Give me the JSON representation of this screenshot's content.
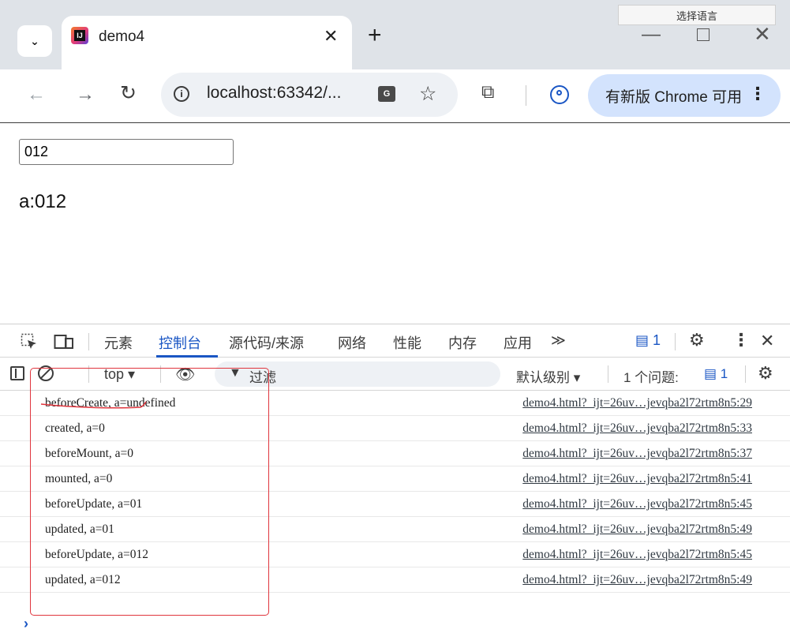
{
  "tooltip": {
    "text": "选择语言"
  },
  "tab": {
    "title": "demo4",
    "favicon_label": "IJ"
  },
  "window_controls": {
    "minimize": "—",
    "close": "✕"
  },
  "toolbar": {
    "url": "localhost:63342/...",
    "update_button_label": "有新版 Chrome 可用",
    "translate_icon_label": "G"
  },
  "page": {
    "input_value": "012",
    "binding_text": "a:012"
  },
  "devtools": {
    "tabs": [
      "元素",
      "控制台",
      "源代码/来源",
      "网络",
      "性能",
      "内存",
      "应用"
    ],
    "more_tabs": "≫",
    "message_count": "1",
    "context": "top ▾",
    "filter_placeholder": "过滤",
    "level": "默认级别 ▾",
    "issues_label": "1 个问题:",
    "issues_count": "1",
    "logs": [
      {
        "message": "beforeCreate, a=undefined",
        "source": "demo4.html?_ijt=26uv…jevqba2l72rtm8n5:29"
      },
      {
        "message": "created, a=0",
        "source": "demo4.html?_ijt=26uv…jevqba2l72rtm8n5:33"
      },
      {
        "message": "beforeMount, a=0",
        "source": "demo4.html?_ijt=26uv…jevqba2l72rtm8n5:37"
      },
      {
        "message": "mounted, a=0",
        "source": "demo4.html?_ijt=26uv…jevqba2l72rtm8n5:41"
      },
      {
        "message": "beforeUpdate, a=01",
        "source": "demo4.html?_ijt=26uv…jevqba2l72rtm8n5:45"
      },
      {
        "message": "updated, a=01",
        "source": "demo4.html?_ijt=26uv…jevqba2l72rtm8n5:49"
      },
      {
        "message": "beforeUpdate, a=012",
        "source": "demo4.html?_ijt=26uv…jevqba2l72rtm8n5:45"
      },
      {
        "message": "updated, a=012",
        "source": "demo4.html?_ijt=26uv…jevqba2l72rtm8n5:49"
      }
    ]
  },
  "colors": {
    "accent": "#1a56c4",
    "annotation_red": "#e0353d",
    "tabstrip_bg": "#dfe3e8"
  }
}
